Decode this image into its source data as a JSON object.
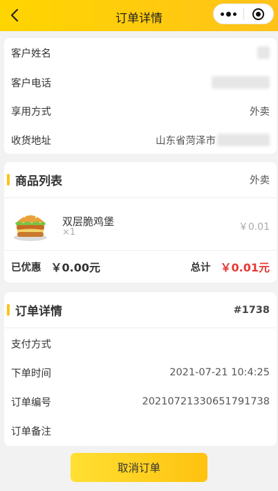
{
  "nav": {
    "title": "订单详情"
  },
  "customer": {
    "name_label": "客户姓名",
    "phone_label": "客户电话",
    "mode_label": "享用方式",
    "mode_value": "外卖",
    "address_label": "收货地址",
    "address_value": "山东省菏泽市"
  },
  "goods": {
    "title": "商品列表",
    "mode": "外卖",
    "items": [
      {
        "name": "双层脆鸡堡",
        "qty": "×1",
        "price": "￥0.01",
        "icon": "chicken-burger-image"
      }
    ],
    "discount_label": "已优惠",
    "discount_value": "￥0.00元",
    "total_label": "总计",
    "total_value": "￥0.01元",
    "accent": "#ffc21a",
    "total_color": "#e53935"
  },
  "order": {
    "title": "订单详情",
    "number_tag": "#1738",
    "pay_label": "支付方式",
    "time_label": "下单时间",
    "time_value": "2021-07-21 10:4:25",
    "no_label": "订单编号",
    "no_value": "20210721330651791738",
    "remark_label": "订单备注"
  },
  "actions": {
    "cancel_label": "取消订单"
  }
}
